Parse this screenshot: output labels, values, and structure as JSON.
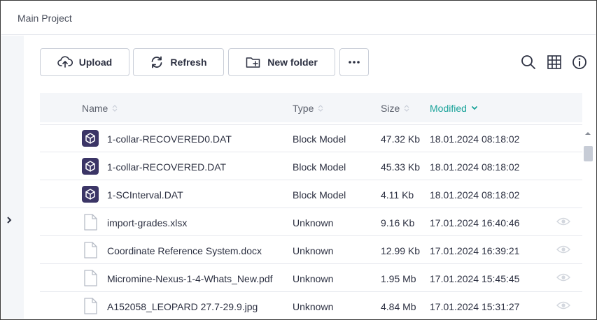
{
  "header": {
    "title": "Main Project"
  },
  "toolbar": {
    "upload_label": "Upload",
    "refresh_label": "Refresh",
    "new_folder_label": "New folder",
    "more_icon": "more-icon",
    "search_icon": "search-icon",
    "grid_icon": "grid-view-icon",
    "info_icon": "info-icon"
  },
  "table": {
    "columns": {
      "name": "Name",
      "type": "Type",
      "size": "Size",
      "modified": "Modified"
    },
    "sorted_column": "Modified",
    "sort_direction": "descending",
    "rows": [
      {
        "icon": "block-model-icon",
        "name": "1-collar-RECOVERED0.DAT",
        "type": "Block Model",
        "size": "47.32 Kb",
        "modified": "18.01.2024 08:18:02",
        "preview": false
      },
      {
        "icon": "block-model-icon",
        "name": "1-collar-RECOVERED.DAT",
        "type": "Block Model",
        "size": "45.33 Kb",
        "modified": "18.01.2024 08:18:02",
        "preview": false
      },
      {
        "icon": "block-model-icon",
        "name": "1-SCInterval.DAT",
        "type": "Block Model",
        "size": "4.11 Kb",
        "modified": "18.01.2024 08:18:02",
        "preview": false
      },
      {
        "icon": "file-icon",
        "name": "import-grades.xlsx",
        "type": "Unknown",
        "size": "9.16 Kb",
        "modified": "17.01.2024 16:40:46",
        "preview": true
      },
      {
        "icon": "file-icon",
        "name": "Coordinate Reference System.docx",
        "type": "Unknown",
        "size": "12.99 Kb",
        "modified": "17.01.2024 16:39:21",
        "preview": true
      },
      {
        "icon": "file-icon",
        "name": "Micromine-Nexus-1-4-Whats_New.pdf",
        "type": "Unknown",
        "size": "1.95 Mb",
        "modified": "17.01.2024 15:45:45",
        "preview": true
      },
      {
        "icon": "file-icon",
        "name": "A152058_LEOPARD 27.7-29.9.jpg",
        "type": "Unknown",
        "size": "4.84 Mb",
        "modified": "17.01.2024 15:31:27",
        "preview": true
      }
    ]
  },
  "colors": {
    "accent": "#1aa39a",
    "block_model_icon_bg": "#3b3566",
    "border": "#c9ced8",
    "header_bg": "#f4f6f9"
  }
}
